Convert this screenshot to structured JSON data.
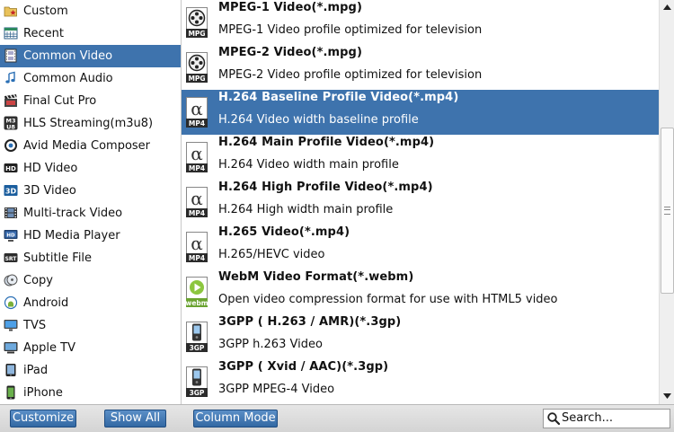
{
  "categories": [
    {
      "label": "Custom",
      "icon": "folder-star-icon"
    },
    {
      "label": "Recent",
      "icon": "calendar-grid-icon"
    },
    {
      "label": "Common Video",
      "icon": "film-strip-icon",
      "selected": true
    },
    {
      "label": "Common Audio",
      "icon": "music-note-icon"
    },
    {
      "label": "Final Cut Pro",
      "icon": "clapperboard-icon"
    },
    {
      "label": "HLS Streaming(m3u8)",
      "icon": "m3u8-icon"
    },
    {
      "label": "Avid Media Composer",
      "icon": "avid-icon"
    },
    {
      "label": "HD Video",
      "icon": "hd-badge-icon"
    },
    {
      "label": "3D Video",
      "icon": "3d-badge-icon"
    },
    {
      "label": "Multi-track Video",
      "icon": "multitrack-film-icon"
    },
    {
      "label": "HD Media Player",
      "icon": "hd-player-icon"
    },
    {
      "label": "Subtitle File",
      "icon": "srt-icon"
    },
    {
      "label": "Copy",
      "icon": "copy-disc-icon"
    },
    {
      "label": "Android",
      "icon": "android-icon"
    },
    {
      "label": "TVS",
      "icon": "tv-icon"
    },
    {
      "label": "Apple TV",
      "icon": "apple-tv-icon"
    },
    {
      "label": "iPad",
      "icon": "ipad-icon"
    },
    {
      "label": "iPhone",
      "icon": "iphone-icon"
    }
  ],
  "formats": [
    {
      "title": "MPEG-1 Video(*.mpg)",
      "desc": "MPEG-1 Video profile optimized for television",
      "badge": "MPG",
      "icon": "mpg-reel-icon"
    },
    {
      "title": "MPEG-2 Video(*.mpg)",
      "desc": "MPEG-2 Video profile optimized for television",
      "badge": "MPG",
      "icon": "mpg-reel-icon"
    },
    {
      "title": "H.264 Baseline Profile Video(*.mp4)",
      "desc": "H.264 Video width baseline profile",
      "badge": "MP4",
      "icon": "mp4-alpha-icon",
      "selected": true
    },
    {
      "title": "H.264 Main Profile Video(*.mp4)",
      "desc": "H.264 Video width main profile",
      "badge": "MP4",
      "icon": "mp4-alpha-icon"
    },
    {
      "title": "H.264 High Profile Video(*.mp4)",
      "desc": "H.264 High width main profile",
      "badge": "MP4",
      "icon": "mp4-alpha-icon"
    },
    {
      "title": "H.265 Video(*.mp4)",
      "desc": "H.265/HEVC video",
      "badge": "MP4",
      "icon": "mp4-alpha-icon"
    },
    {
      "title": "WebM Video Format(*.webm)",
      "desc": "Open video compression format for use with HTML5 video",
      "badge": "webm",
      "icon": "webm-play-icon"
    },
    {
      "title": "3GPP ( H.263 / AMR)(*.3gp)",
      "desc": "3GPP h.263 Video",
      "badge": "3GP",
      "icon": "3gp-phone-icon"
    },
    {
      "title": "3GPP ( Xvid / AAC)(*.3gp)",
      "desc": "3GPP MPEG-4 Video",
      "badge": "3GP",
      "icon": "3gp-phone-icon"
    }
  ],
  "buttons": {
    "customize": "Customize",
    "show_all": "Show All",
    "column_mode": "Column Mode"
  },
  "search": {
    "placeholder": "Search..."
  },
  "colors": {
    "selection": "#3e73ad",
    "button": "#4a7fba"
  }
}
